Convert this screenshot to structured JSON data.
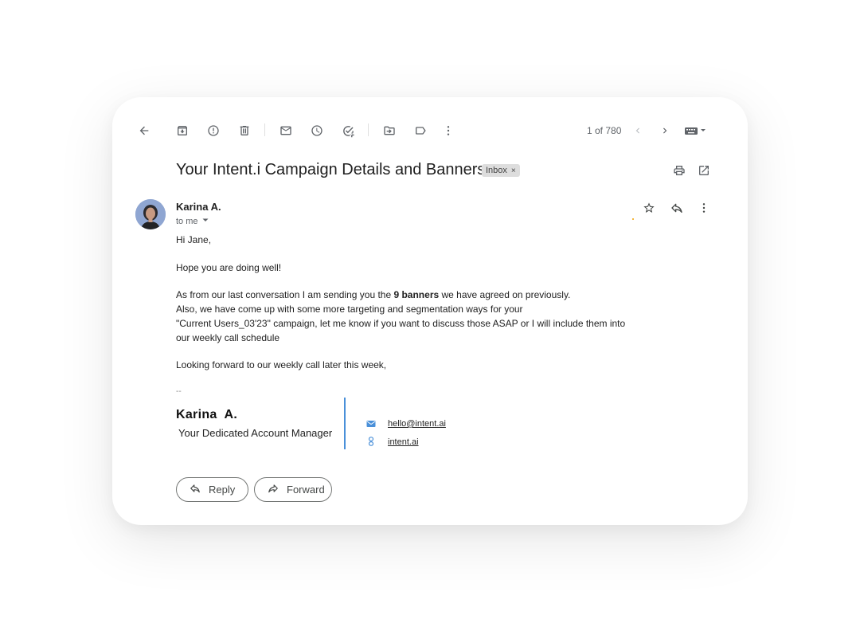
{
  "toolbar": {
    "icons": [
      "back-arrow-icon",
      "archive-icon",
      "report-spam-icon",
      "delete-icon",
      "mark-unread-icon",
      "snooze-icon",
      "add-task-icon",
      "move-to-icon",
      "label-icon",
      "more-vert-icon"
    ],
    "counter": "1 of 780",
    "nav": [
      "chevron-left-icon",
      "chevron-right-icon",
      "keyboard-icon"
    ]
  },
  "subject": {
    "title": "Your Intent.i Campaign Details and Banners.",
    "badge": "Inbox",
    "badge_close": "×"
  },
  "sender": {
    "name": "Karina A.",
    "recipient": "to me"
  },
  "message": {
    "greeting": "Hi Jane,",
    "line1": "Hope you are doing well!",
    "line2_a": "As from our last conversation I am sending you the ",
    "line2_bold": "9 banners",
    "line2_b": " we have agreed on previously.",
    "line3": "Also, we have come up with some more targeting and segmentation ways for your",
    "line4": "\"Current Users_03'23\" campaign, let me know if you want to discuss those ASAP or I will include them into",
    "line5": "our weekly call schedule",
    "line6": "Looking forward to our weekly call later this week,"
  },
  "signature": {
    "dash": "--",
    "name": "Karina  A.",
    "role": "Your Dedicated Account Manager",
    "email": "hello@intent.ai",
    "website": "intent.ai"
  },
  "actions": {
    "reply": "Reply",
    "forward": "Forward"
  },
  "colors": {
    "accent_blue": "#4a90d9",
    "icon_gray": "#5f6368"
  }
}
